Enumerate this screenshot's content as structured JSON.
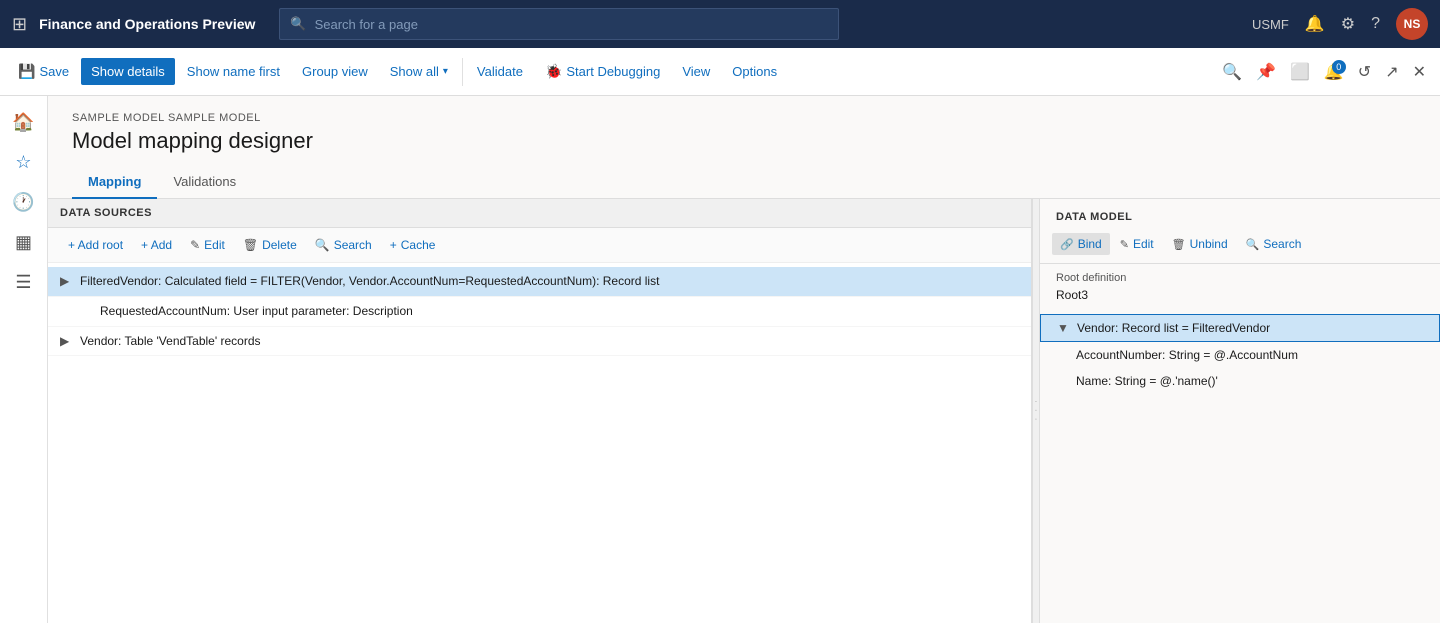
{
  "app": {
    "title": "Finance and Operations Preview",
    "env_label": "USMF"
  },
  "search_bar": {
    "placeholder": "Search for a page"
  },
  "toolbar": {
    "save_label": "Save",
    "show_details_label": "Show details",
    "show_name_first_label": "Show name first",
    "group_view_label": "Group view",
    "show_all_label": "Show all",
    "validate_label": "Validate",
    "start_debugging_label": "Start Debugging",
    "view_label": "View",
    "options_label": "Options"
  },
  "page": {
    "breadcrumb": "SAMPLE MODEL SAMPLE MODEL",
    "title": "Model mapping designer",
    "tabs": [
      {
        "label": "Mapping",
        "active": true
      },
      {
        "label": "Validations",
        "active": false
      }
    ]
  },
  "left_panel": {
    "section_header": "DATA SOURCES",
    "add_root_label": "+ Add root",
    "add_label": "+ Add",
    "edit_label": "Edit",
    "delete_label": "Delete",
    "search_label": "Search",
    "cache_label": "Cache",
    "tree_items": [
      {
        "id": 1,
        "text": "FilteredVendor: Calculated field = FILTER(Vendor, Vendor.AccountNum=RequestedAccountNum): Record list",
        "indent": 0,
        "expandable": true,
        "selected": true
      },
      {
        "id": 2,
        "text": "RequestedAccountNum: User input parameter: Description",
        "indent": 1,
        "expandable": false,
        "selected": false
      },
      {
        "id": 3,
        "text": "Vendor: Table 'VendTable' records",
        "indent": 0,
        "expandable": true,
        "selected": false
      }
    ]
  },
  "right_panel": {
    "header": "DATA MODEL",
    "bind_label": "Bind",
    "edit_label": "Edit",
    "unbind_label": "Unbind",
    "search_label": "Search",
    "root_definition_label": "Root definition",
    "root_definition_value": "Root3",
    "tree_items": [
      {
        "id": 1,
        "text": "Vendor: Record list = FilteredVendor",
        "indent": 0,
        "expandable": true,
        "expanded": true,
        "selected": true
      },
      {
        "id": 2,
        "text": "AccountNumber: String = @.AccountNum",
        "indent": 1,
        "expandable": false,
        "selected": false
      },
      {
        "id": 3,
        "text": "Name: String = @.'name()'",
        "indent": 1,
        "expandable": false,
        "selected": false
      }
    ]
  }
}
